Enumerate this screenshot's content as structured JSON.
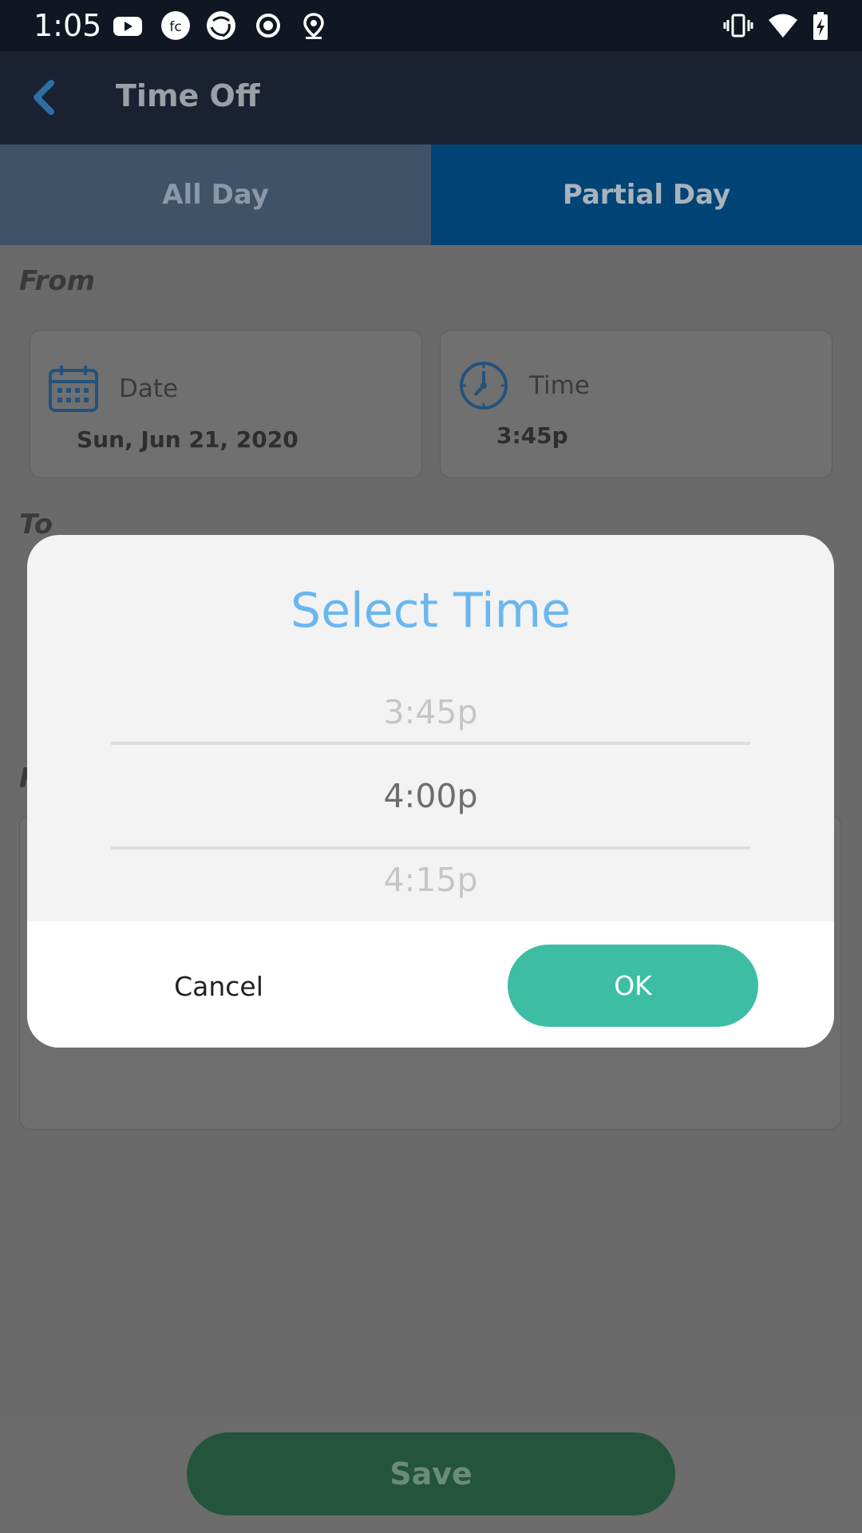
{
  "status_bar": {
    "time": "1:05",
    "icons": [
      "youtube-icon",
      "fc-app-icon",
      "aperture-icon",
      "record-icon",
      "location-icon",
      "vibrate-icon",
      "wifi-icon",
      "battery-charging-icon"
    ]
  },
  "app_bar": {
    "title": "Time Off",
    "back_icon": "back-chevron-icon"
  },
  "tabs": [
    {
      "label": "All Day",
      "selected": false
    },
    {
      "label": "Partial Day",
      "selected": true
    }
  ],
  "from": {
    "label": "From",
    "date": {
      "label": "Date",
      "value": "Sun, Jun 21, 2020",
      "icon": "calendar-icon"
    },
    "time": {
      "label": "Time",
      "value": "3:45p",
      "icon": "clock-icon"
    }
  },
  "to": {
    "label": "To"
  },
  "partial_label": "R",
  "save_label": "Save",
  "dialog": {
    "title": "Select Time",
    "options": [
      "3:45p",
      "4:00p",
      "4:15p"
    ],
    "selected": "4:00p",
    "cancel_label": "Cancel",
    "ok_label": "OK"
  },
  "colors": {
    "accent_blue": "#6ab7f0",
    "ok_green": "#3dbea4",
    "save_green": "#24553c",
    "tab_selected": "#004476"
  }
}
